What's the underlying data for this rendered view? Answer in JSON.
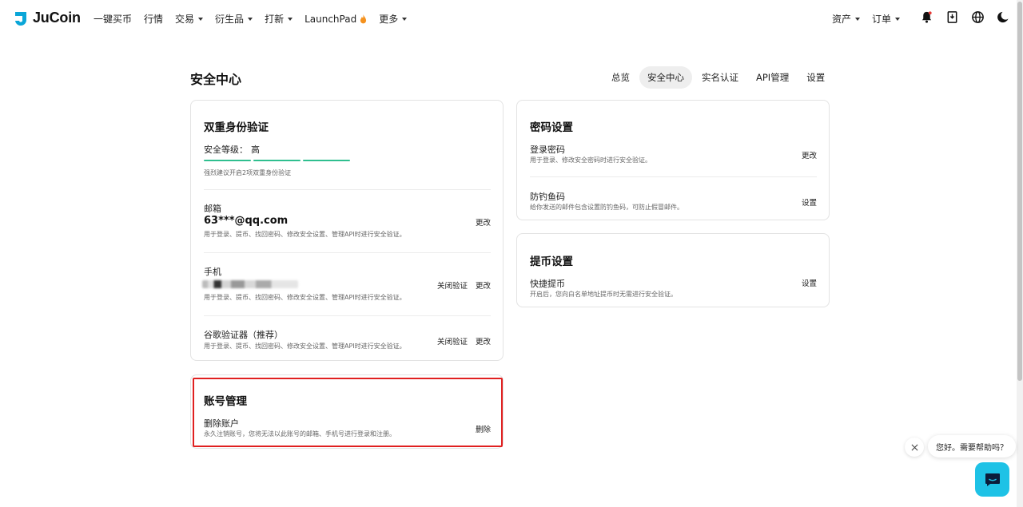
{
  "header": {
    "logo_text": "JuCoin",
    "nav": [
      {
        "label": "一键买币",
        "has_caret": false
      },
      {
        "label": "行情",
        "has_caret": false
      },
      {
        "label": "交易",
        "has_caret": true
      },
      {
        "label": "衍生品",
        "has_caret": true
      },
      {
        "label": "打新",
        "has_caret": true
      },
      {
        "label": "LaunchPad",
        "has_caret": false
      },
      {
        "label": "更多",
        "has_caret": true
      }
    ],
    "right_nav": [
      {
        "label": "资产"
      },
      {
        "label": "订单"
      }
    ],
    "icons": [
      "bell-icon",
      "download-icon",
      "globe-icon",
      "moon-icon"
    ]
  },
  "page": {
    "title": "安全中心",
    "tabs": [
      {
        "label": "总览",
        "active": false
      },
      {
        "label": "安全中心",
        "active": true
      },
      {
        "label": "实名认证",
        "active": false
      },
      {
        "label": "API管理",
        "active": false
      },
      {
        "label": "设置",
        "active": false
      }
    ]
  },
  "two_factor": {
    "title": "双重身份验证",
    "level_label": "安全等级：",
    "level_value": "高",
    "level_bars_filled": 3,
    "level_bars_total": 3,
    "hint": "强烈建议开启2项双重身份验证",
    "email": {
      "label": "邮箱",
      "value": "63***@qq.com",
      "desc": "用于登录、提币、找回密码、修改安全设置、管理API时进行安全验证。",
      "action": "更改"
    },
    "phone": {
      "label": "手机",
      "desc": "用于登录、提币、找回密码、修改安全设置、管理API时进行安全验证。",
      "action_disable": "关闭验证",
      "action_change": "更改"
    },
    "google": {
      "label": "谷歌验证器（推荐）",
      "desc": "用于登录、提币、找回密码、修改安全设置、管理API时进行安全验证。",
      "action_disable": "关闭验证",
      "action_change": "更改"
    }
  },
  "account": {
    "title": "账号管理",
    "delete": {
      "label": "删除账户",
      "desc": "永久注销账号，您将无法以此账号的邮箱、手机号进行登录和注册。",
      "action": "删除"
    }
  },
  "password": {
    "title": "密码设置",
    "login": {
      "label": "登录密码",
      "desc": "用于登录、修改安全密码时进行安全验证。",
      "action": "更改"
    },
    "antiphishing": {
      "label": "防钓鱼码",
      "desc": "给你发送的邮件包含设置防钓鱼码，可防止假冒邮件。",
      "action": "设置"
    }
  },
  "withdraw": {
    "title": "提币设置",
    "quick": {
      "label": "快捷提币",
      "desc": "开启后，您向白名单地址提币时无需进行安全验证。",
      "action": "设置"
    }
  },
  "chat": {
    "greeting": "您好。需要帮助吗？"
  },
  "colors": {
    "accent_green": "#2fbf8f",
    "highlight_red": "#e02020",
    "chat_cyan": "#1ec2e6",
    "logo_blue": "#0aa6d8"
  }
}
